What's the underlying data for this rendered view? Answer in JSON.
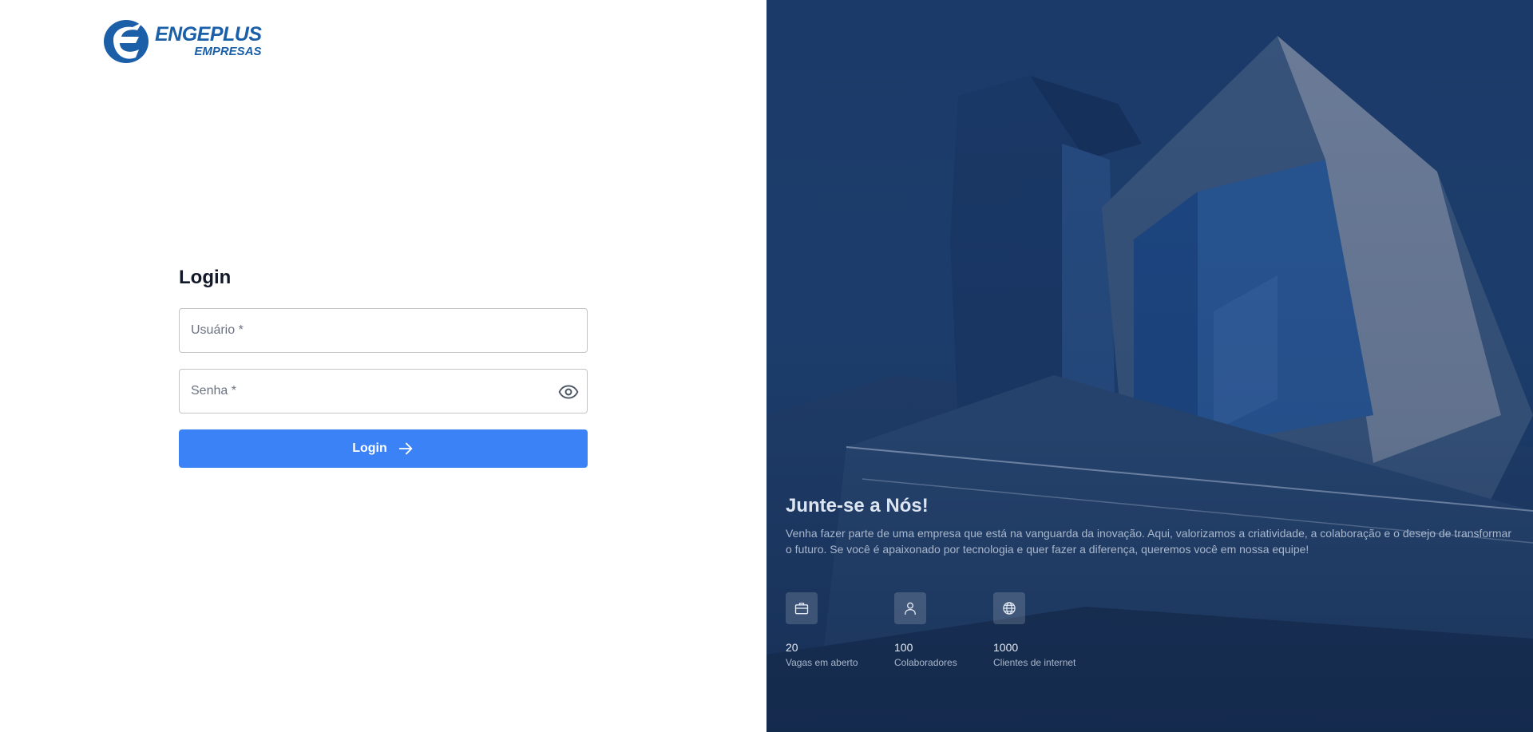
{
  "logo": {
    "brand": "ENGEPLUS",
    "sub": "EMPRESAS"
  },
  "login": {
    "title": "Login",
    "username_placeholder": "Usuário *",
    "password_placeholder": "Senha *",
    "button_label": "Login",
    "accent_color": "#3b82f6"
  },
  "promo": {
    "title": "Junte-se a Nós!",
    "text": "Venha fazer parte de uma empresa que está na vanguarda da inovação. Aqui, valorizamos a criatividade, a colaboração e o desejo de transformar o futuro. Se você é apaixonado por tecnologia e quer fazer a diferença, queremos você em nossa equipe!",
    "stats": [
      {
        "icon": "briefcase-icon",
        "value": "20",
        "label": "Vagas em aberto"
      },
      {
        "icon": "user-icon",
        "value": "100",
        "label": "Colaboradores"
      },
      {
        "icon": "globe-icon",
        "value": "1000",
        "label": "Clientes de internet"
      }
    ]
  }
}
